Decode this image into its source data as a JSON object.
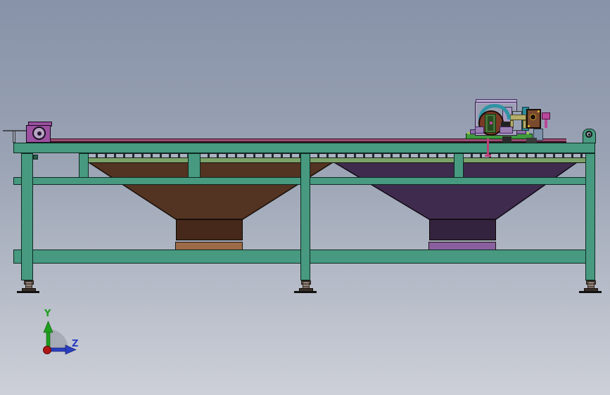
{
  "view": {
    "description": "side orthographic view of twin-hopper conveyor machine frame"
  },
  "triad": {
    "y_label": "Y",
    "z_label": "Z"
  },
  "colors": {
    "bg_top": "#8892a8",
    "bg_bottom": "#cdd0d8",
    "frame": "#47997f",
    "frame_edge": "#0d2b22",
    "belt": "#9b4a71",
    "deck": "#7ba269",
    "roller": "#a9b3c1",
    "roller_gap": "#232a30",
    "hopper1": "#533321",
    "chute1": "#46291a",
    "flange1": "#9c6a47",
    "hopper2": "#3f2b4d",
    "chute2": "#34233f",
    "flange2": "#8a5fa0",
    "motor": "#9b50a0",
    "axis_y": "#1e9e1e",
    "axis_z": "#2a3ec0",
    "axis_origin": "#b01616",
    "axis_arc": "#a4a7b1"
  }
}
